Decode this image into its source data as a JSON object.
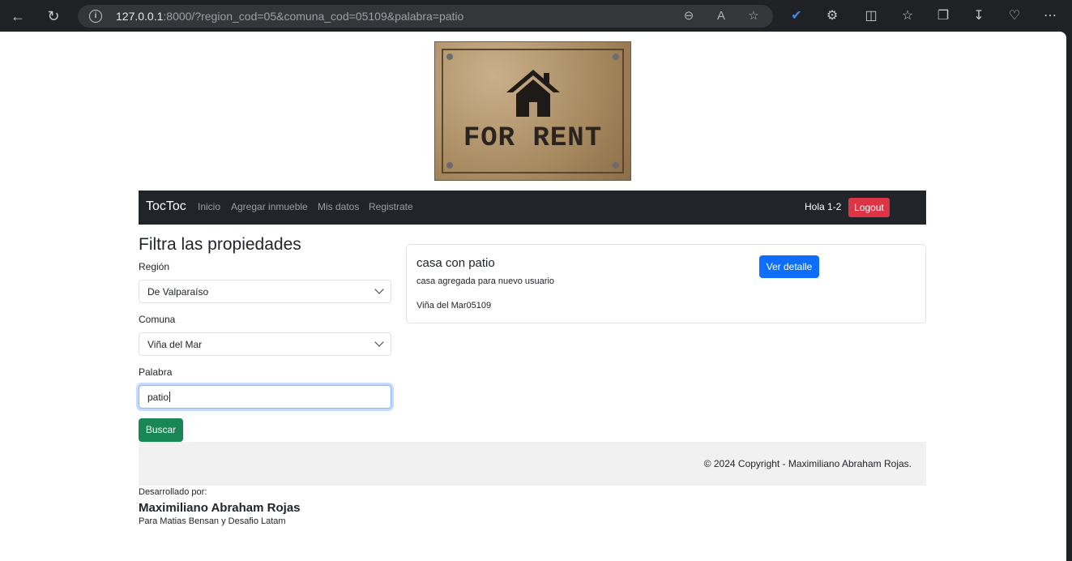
{
  "browser": {
    "url_host": "127.0.0.1",
    "url_rest": ":8000/?region_cod=05&comuna_cod=05109&palabra=patio"
  },
  "banner": {
    "text": "FOR RENT"
  },
  "navbar": {
    "brand": "TocToc",
    "links": [
      "Inicio",
      "Agregar inmueble",
      "Mis datos",
      "Registrate"
    ],
    "greeting": "Hola 1-2",
    "logout_label": "Logout"
  },
  "filter": {
    "title": "Filtra las propiedades",
    "region_label": "Región",
    "region_value": "De Valparaíso",
    "comuna_label": "Comuna",
    "comuna_value": "Viña del Mar",
    "palabra_label": "Palabra",
    "palabra_value": "patio",
    "search_label": "Buscar"
  },
  "results": [
    {
      "title": "casa con patio",
      "description": "casa agregada para nuevo usuario",
      "location": "Viña del Mar05109",
      "button_label": "Ver detalle"
    }
  ],
  "footer": {
    "copyright": "© 2024 Copyright - Maximiliano Abraham Rojas.",
    "dev_label": "Desarrollado por:",
    "dev_name": "Maximiliano Abraham Rojas",
    "dev_sub": "Para Matias Bensan y Desafio Latam"
  },
  "colors": {
    "navbar": "#212529",
    "logout": "#dc3545",
    "primary": "#0d6efd",
    "success": "#198754"
  }
}
